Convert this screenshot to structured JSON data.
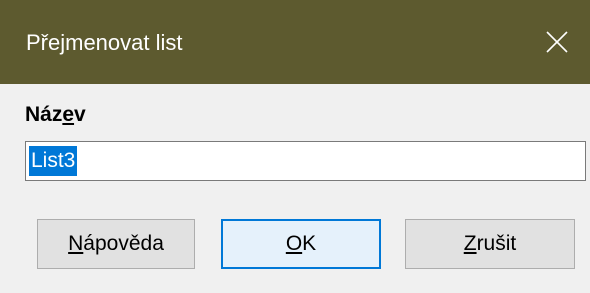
{
  "window": {
    "title": "Přejmenovat list",
    "titlebar_color": "#5d5a2f",
    "close_icon": "close-icon"
  },
  "form": {
    "label_pre": "Náz",
    "label_accel": "e",
    "label_post": "v",
    "input_value": "List3",
    "input_selected": true
  },
  "buttons": {
    "help": {
      "accel": "N",
      "rest": "ápověda"
    },
    "ok": {
      "accel": "O",
      "rest": "K",
      "default": true
    },
    "cancel": {
      "accel": "Z",
      "rest": "rušit"
    }
  },
  "colors": {
    "selection": "#0078d7",
    "default_button_border": "#0078d7"
  }
}
